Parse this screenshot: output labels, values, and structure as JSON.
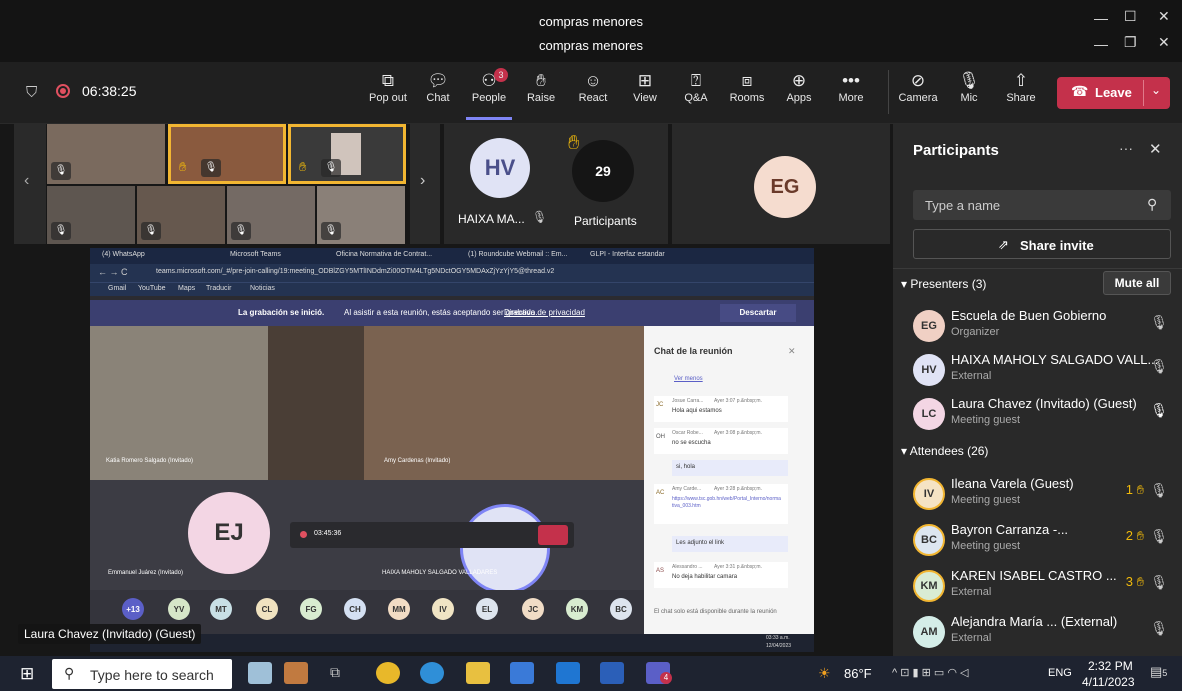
{
  "window": {
    "title_top": "compras menores",
    "title_bottom": "compras menores"
  },
  "toolbar": {
    "timer": "06:38:25",
    "popout": "Pop out",
    "chat": "Chat",
    "people": "People",
    "people_badge": "3",
    "raise": "Raise",
    "react": "React",
    "view": "View",
    "qa": "Q&A",
    "rooms": "Rooms",
    "apps": "Apps",
    "more": "More",
    "camera": "Camera",
    "mic": "Mic",
    "share": "Share",
    "leave": "Leave"
  },
  "stage": {
    "hv_initials": "HV",
    "hv_name": "HAIXA MA...",
    "participants_count": "29",
    "participants_label": "Participants",
    "eg_initials": "EG"
  },
  "shared_screen": {
    "tabs": [
      "(4) WhatsApp",
      "Microsoft Teams",
      "Oficina Normativa de Contrat...",
      "(1) Roundcube Webmail :: Em...",
      "GLPI - Interfaz estandar"
    ],
    "url": "teams.microsoft.com/_#/pre-join-calling/19:meeting_ODBlZGY5MTlINDdmZi00OTM4LTg5NDctOGY5MDAxZjYzYjY5@thread.v2",
    "bookmarks": [
      "Gmail",
      "YouTube",
      "Maps",
      "Traducir",
      "Noticias"
    ],
    "banner_text": "La grabación se inició.",
    "banner_rest": "Al asistir a esta reunión, estás aceptando ser grabado.",
    "banner_link": "Directiva de privacidad",
    "banner_button": "Descartar",
    "video_label_left": "Katia Romero Salgado (Invitado)",
    "video_label_right": "Amy Cardenas (Invitado)",
    "ej_initials": "EJ",
    "ej_name": "Emmanuel Juárez (Invitado)",
    "hv_name_inner": "HAIXA MAHOLY SALGADO VALLADARES",
    "inner_timer": "03:45:36",
    "chat_title": "Chat de la reunión",
    "chat_more": "Ver menos",
    "chat_messages": [
      {
        "initials": "JC",
        "author": "Josue Carra...",
        "time": "Ayer 3:07 p.&nbsp;m.",
        "text": "Hola aqui estamos"
      },
      {
        "initials": "OH",
        "author": "Oscar Robe...",
        "time": "Ayer 3:08 p.&nbsp;m.",
        "text": "no se escucha"
      },
      {
        "initials": "",
        "author": "",
        "time": "",
        "text": "si, hola"
      },
      {
        "initials": "AC",
        "author": "Amy Carde...",
        "time": "Ayer 3:28 p.&nbsp;m.",
        "text": "https://www.tsc.gob.hn/web/Portal_Interno/normativa_003.htm"
      },
      {
        "initials": "",
        "author": "",
        "time": "",
        "text": "Les adjunto el link"
      },
      {
        "initials": "AS",
        "author": "Alessandro ...",
        "time": "Ayer 3:31 p.&nbsp;m.",
        "text": "No deja habilitar camara"
      }
    ],
    "chat_footer": "El chat solo está disponible durante la reunión",
    "chips": [
      "+13",
      "YV",
      "MT",
      "CL",
      "FG",
      "CH",
      "MM",
      "IV",
      "EL",
      "JC",
      "KM",
      "BC"
    ],
    "inner_clock_time": "03:33 a.m.",
    "inner_clock_date": "12/04/2023"
  },
  "caption": "Laura Chavez (Invitado) (Guest)",
  "panel": {
    "title": "Participants",
    "search_placeholder": "Type a name",
    "share_invite": "Share invite",
    "presenters_header": "Presenters (3)",
    "mute_all": "Mute all",
    "presenters": [
      {
        "initials": "EG",
        "name": "Escuela de Buen Gobierno",
        "role": "Organizer",
        "color": "#f0d0c4"
      },
      {
        "initials": "HV",
        "name": "HAIXA MAHOLY SALGADO VALL...",
        "role": "External",
        "color": "#e0e3f5"
      },
      {
        "initials": "LC",
        "name": "Laura Chavez (Invitado) (Guest)",
        "role": "Meeting guest",
        "color": "#f3d6e4"
      }
    ],
    "attendees_header": "Attendees (26)",
    "attendees": [
      {
        "initials": "IV",
        "name": "Ileana Varela (Guest)",
        "role": "Meeting guest",
        "hand": "1",
        "color": "#f5e3c4"
      },
      {
        "initials": "BC",
        "name": "Bayron Carranza -...",
        "role": "Meeting guest",
        "hand": "2",
        "color": "#dde6f0"
      },
      {
        "initials": "KM",
        "name": "KAREN ISABEL CASTRO ...",
        "role": "External",
        "hand": "3",
        "color": "#d9ecd4"
      },
      {
        "initials": "AM",
        "name": "Alejandra María ... (External)",
        "role": "External",
        "hand": "",
        "color": "#d4ede8"
      }
    ]
  },
  "taskbar": {
    "search_placeholder": "Type here to search",
    "temperature": "86°F",
    "language": "ENG",
    "time": "2:32 PM",
    "date": "4/11/2023",
    "teams_badge": "4",
    "notif_badge": "5"
  },
  "colors": {
    "accent": "#7f85f5",
    "leave": "#c4314b",
    "hand": "#f0b90b",
    "raised_border": "#f2b632"
  }
}
